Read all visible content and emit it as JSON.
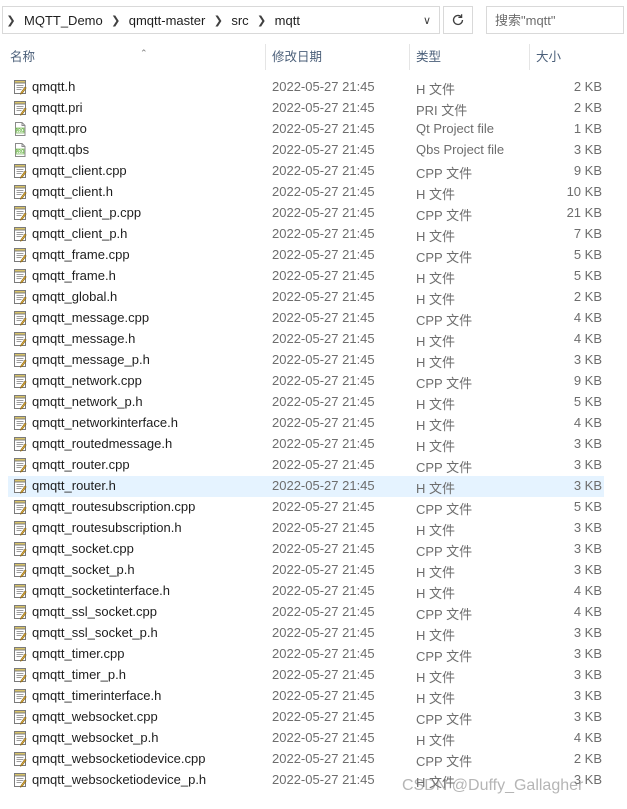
{
  "address_bar": {
    "crumbs": [
      "MQTT_Demo",
      "qmqtt-master",
      "src",
      "mqtt"
    ]
  },
  "search": {
    "placeholder": "搜索\"mqtt\""
  },
  "columns": {
    "name": "名称",
    "date": "修改日期",
    "type": "类型",
    "size": "大小"
  },
  "files": [
    {
      "name": "qmqtt.h",
      "date": "2022-05-27 21:45",
      "type": "H 文件",
      "size": "2 KB",
      "icon": "header-file-icon"
    },
    {
      "name": "qmqtt.pri",
      "date": "2022-05-27 21:45",
      "type": "PRI 文件",
      "size": "2 KB",
      "icon": "header-file-icon"
    },
    {
      "name": "qmqtt.pro",
      "date": "2022-05-27 21:45",
      "type": "Qt Project file",
      "size": "1 KB",
      "icon": "qt-project-icon"
    },
    {
      "name": "qmqtt.qbs",
      "date": "2022-05-27 21:45",
      "type": "Qbs Project file",
      "size": "3 KB",
      "icon": "qt-project-icon"
    },
    {
      "name": "qmqtt_client.cpp",
      "date": "2022-05-27 21:45",
      "type": "CPP 文件",
      "size": "9 KB",
      "icon": "cpp-file-icon"
    },
    {
      "name": "qmqtt_client.h",
      "date": "2022-05-27 21:45",
      "type": "H 文件",
      "size": "10 KB",
      "icon": "header-file-icon"
    },
    {
      "name": "qmqtt_client_p.cpp",
      "date": "2022-05-27 21:45",
      "type": "CPP 文件",
      "size": "21 KB",
      "icon": "cpp-file-icon"
    },
    {
      "name": "qmqtt_client_p.h",
      "date": "2022-05-27 21:45",
      "type": "H 文件",
      "size": "7 KB",
      "icon": "header-file-icon"
    },
    {
      "name": "qmqtt_frame.cpp",
      "date": "2022-05-27 21:45",
      "type": "CPP 文件",
      "size": "5 KB",
      "icon": "cpp-file-icon"
    },
    {
      "name": "qmqtt_frame.h",
      "date": "2022-05-27 21:45",
      "type": "H 文件",
      "size": "5 KB",
      "icon": "header-file-icon"
    },
    {
      "name": "qmqtt_global.h",
      "date": "2022-05-27 21:45",
      "type": "H 文件",
      "size": "2 KB",
      "icon": "header-file-icon"
    },
    {
      "name": "qmqtt_message.cpp",
      "date": "2022-05-27 21:45",
      "type": "CPP 文件",
      "size": "4 KB",
      "icon": "cpp-file-icon"
    },
    {
      "name": "qmqtt_message.h",
      "date": "2022-05-27 21:45",
      "type": "H 文件",
      "size": "4 KB",
      "icon": "header-file-icon"
    },
    {
      "name": "qmqtt_message_p.h",
      "date": "2022-05-27 21:45",
      "type": "H 文件",
      "size": "3 KB",
      "icon": "header-file-icon"
    },
    {
      "name": "qmqtt_network.cpp",
      "date": "2022-05-27 21:45",
      "type": "CPP 文件",
      "size": "9 KB",
      "icon": "cpp-file-icon"
    },
    {
      "name": "qmqtt_network_p.h",
      "date": "2022-05-27 21:45",
      "type": "H 文件",
      "size": "5 KB",
      "icon": "header-file-icon"
    },
    {
      "name": "qmqtt_networkinterface.h",
      "date": "2022-05-27 21:45",
      "type": "H 文件",
      "size": "4 KB",
      "icon": "header-file-icon"
    },
    {
      "name": "qmqtt_routedmessage.h",
      "date": "2022-05-27 21:45",
      "type": "H 文件",
      "size": "3 KB",
      "icon": "header-file-icon"
    },
    {
      "name": "qmqtt_router.cpp",
      "date": "2022-05-27 21:45",
      "type": "CPP 文件",
      "size": "3 KB",
      "icon": "cpp-file-icon"
    },
    {
      "name": "qmqtt_router.h",
      "date": "2022-05-27 21:45",
      "type": "H 文件",
      "size": "3 KB",
      "icon": "header-file-icon",
      "selected": true
    },
    {
      "name": "qmqtt_routesubscription.cpp",
      "date": "2022-05-27 21:45",
      "type": "CPP 文件",
      "size": "5 KB",
      "icon": "cpp-file-icon"
    },
    {
      "name": "qmqtt_routesubscription.h",
      "date": "2022-05-27 21:45",
      "type": "H 文件",
      "size": "3 KB",
      "icon": "header-file-icon"
    },
    {
      "name": "qmqtt_socket.cpp",
      "date": "2022-05-27 21:45",
      "type": "CPP 文件",
      "size": "3 KB",
      "icon": "cpp-file-icon"
    },
    {
      "name": "qmqtt_socket_p.h",
      "date": "2022-05-27 21:45",
      "type": "H 文件",
      "size": "3 KB",
      "icon": "header-file-icon"
    },
    {
      "name": "qmqtt_socketinterface.h",
      "date": "2022-05-27 21:45",
      "type": "H 文件",
      "size": "4 KB",
      "icon": "header-file-icon"
    },
    {
      "name": "qmqtt_ssl_socket.cpp",
      "date": "2022-05-27 21:45",
      "type": "CPP 文件",
      "size": "4 KB",
      "icon": "cpp-file-icon"
    },
    {
      "name": "qmqtt_ssl_socket_p.h",
      "date": "2022-05-27 21:45",
      "type": "H 文件",
      "size": "3 KB",
      "icon": "header-file-icon"
    },
    {
      "name": "qmqtt_timer.cpp",
      "date": "2022-05-27 21:45",
      "type": "CPP 文件",
      "size": "3 KB",
      "icon": "cpp-file-icon"
    },
    {
      "name": "qmqtt_timer_p.h",
      "date": "2022-05-27 21:45",
      "type": "H 文件",
      "size": "3 KB",
      "icon": "header-file-icon"
    },
    {
      "name": "qmqtt_timerinterface.h",
      "date": "2022-05-27 21:45",
      "type": "H 文件",
      "size": "3 KB",
      "icon": "header-file-icon"
    },
    {
      "name": "qmqtt_websocket.cpp",
      "date": "2022-05-27 21:45",
      "type": "CPP 文件",
      "size": "3 KB",
      "icon": "cpp-file-icon"
    },
    {
      "name": "qmqtt_websocket_p.h",
      "date": "2022-05-27 21:45",
      "type": "H 文件",
      "size": "4 KB",
      "icon": "header-file-icon"
    },
    {
      "name": "qmqtt_websocketiodevice.cpp",
      "date": "2022-05-27 21:45",
      "type": "CPP 文件",
      "size": "2 KB",
      "icon": "cpp-file-icon"
    },
    {
      "name": "qmqtt_websocketiodevice_p.h",
      "date": "2022-05-27 21:45",
      "type": "H 文件",
      "size": "3 KB",
      "icon": "header-file-icon"
    }
  ],
  "watermark": "CSDN @Duffy_Gallagher",
  "colors": {
    "selected_row": "#e5f3ff",
    "header_text": "#4c607a",
    "secondary_text": "#6d6d6d"
  }
}
